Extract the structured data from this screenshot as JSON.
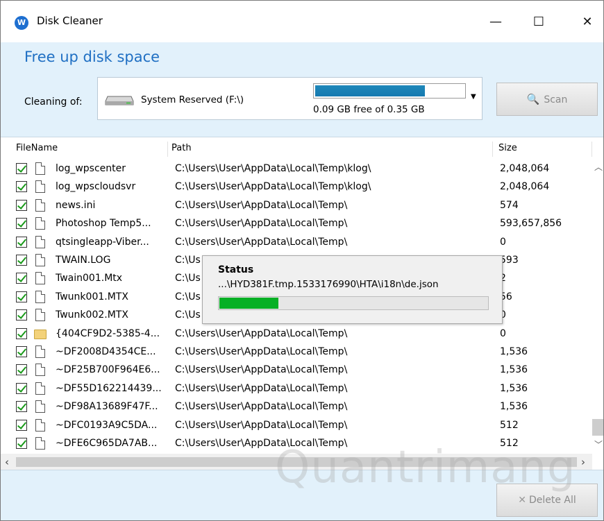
{
  "window": {
    "title": "Disk Cleaner",
    "controls": {
      "minimize": "—",
      "maximize": "☐",
      "close": "✕"
    }
  },
  "header": {
    "title": "Free up disk space",
    "cleaning_label": "Cleaning of:",
    "drive": {
      "name": "System Reserved (F:\\)",
      "free_text": "0.09 GB free of 0.35 GB",
      "usage_fraction": 0.74
    },
    "scan_label": "Scan"
  },
  "columns": {
    "name": "FileName",
    "path": "Path",
    "size": "Size"
  },
  "rows": [
    {
      "name": "log_wpscenter",
      "path": "C:\\Users\\User\\AppData\\Local\\Temp\\klog\\",
      "size": "2,048,064",
      "type": "file",
      "checked": true
    },
    {
      "name": "log_wpscloudsvr",
      "path": "C:\\Users\\User\\AppData\\Local\\Temp\\klog\\",
      "size": "2,048,064",
      "type": "file",
      "checked": true
    },
    {
      "name": "news.ini",
      "path": "C:\\Users\\User\\AppData\\Local\\Temp\\",
      "size": "574",
      "type": "file",
      "checked": true
    },
    {
      "name": "Photoshop Temp5...",
      "path": "C:\\Users\\User\\AppData\\Local\\Temp\\",
      "size": "593,657,856",
      "type": "file",
      "checked": true
    },
    {
      "name": "qtsingleapp-Viber...",
      "path": "C:\\Users\\User\\AppData\\Local\\Temp\\",
      "size": "0",
      "type": "file",
      "checked": true
    },
    {
      "name": "TWAIN.LOG",
      "path": "C:\\Us",
      "size": "593",
      "type": "file",
      "checked": true
    },
    {
      "name": "Twain001.Mtx",
      "path": "C:\\Us",
      "size": "2",
      "type": "file",
      "checked": true
    },
    {
      "name": "Twunk001.MTX",
      "path": "C:\\Us",
      "size": "56",
      "type": "file",
      "checked": true
    },
    {
      "name": "Twunk002.MTX",
      "path": "C:\\Us",
      "size": "0",
      "type": "file",
      "checked": true
    },
    {
      "name": "{404CF9D2-5385-4...",
      "path": "C:\\Users\\User\\AppData\\Local\\Temp\\",
      "size": "0",
      "type": "folder",
      "checked": true
    },
    {
      "name": "~DF2008D4354CE...",
      "path": "C:\\Users\\User\\AppData\\Local\\Temp\\",
      "size": "1,536",
      "type": "file",
      "checked": true
    },
    {
      "name": "~DF25B700F964E6...",
      "path": "C:\\Users\\User\\AppData\\Local\\Temp\\",
      "size": "1,536",
      "type": "file",
      "checked": true
    },
    {
      "name": "~DF55D162214439...",
      "path": "C:\\Users\\User\\AppData\\Local\\Temp\\",
      "size": "1,536",
      "type": "file",
      "checked": true
    },
    {
      "name": "~DF98A13689F47F...",
      "path": "C:\\Users\\User\\AppData\\Local\\Temp\\",
      "size": "1,536",
      "type": "file",
      "checked": true
    },
    {
      "name": "~DFC0193A9C5DA...",
      "path": "C:\\Users\\User\\AppData\\Local\\Temp\\",
      "size": "512",
      "type": "file",
      "checked": true
    },
    {
      "name": "~DFE6C965DA7AB...",
      "path": "C:\\Users\\User\\AppData\\Local\\Temp\\",
      "size": "512",
      "type": "file",
      "checked": true
    }
  ],
  "status": {
    "title": "Status",
    "current_file": "...\\HYD381F.tmp.1533176990\\HTA\\i18n\\de.json",
    "progress_fraction": 0.22
  },
  "footer": {
    "delete_label": "Delete All"
  },
  "watermark": "Quantrimang",
  "colors": {
    "accent": "#1f6fc3",
    "header_bg": "#e2f1fb",
    "progress": "#06b025",
    "space_bar": "#1f88ba"
  }
}
